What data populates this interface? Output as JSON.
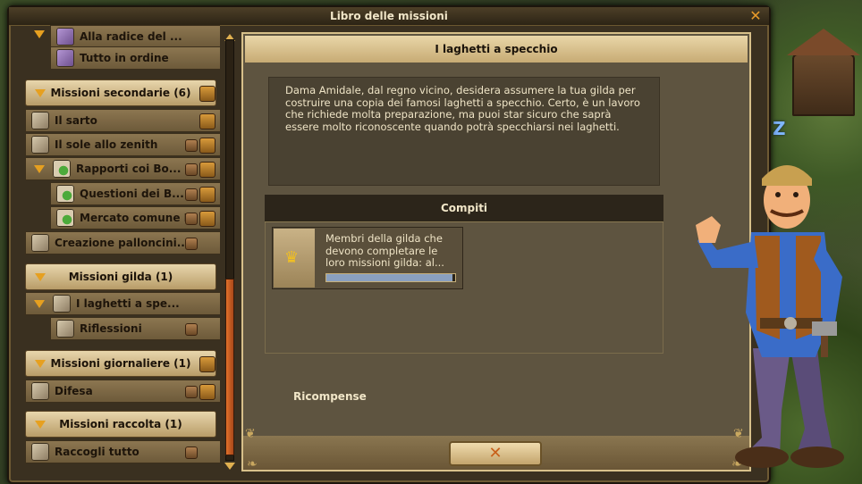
{
  "window": {
    "title": "Libro delle missioni"
  },
  "sidebar": {
    "items": [
      {
        "kind": "sub",
        "label": "Alla radice del ...",
        "icon": "purple-scroll-icon"
      },
      {
        "kind": "sub",
        "label": "Tutto in ordine",
        "icon": "purple-scroll-icon"
      },
      {
        "kind": "category",
        "label": "Missioni secondarie (6)"
      },
      {
        "kind": "quest",
        "label": "Il sarto"
      },
      {
        "kind": "quest",
        "label": "Il sole allo zenith"
      },
      {
        "kind": "quest-expand",
        "label": "Rapporti coi Bo..."
      },
      {
        "kind": "sub",
        "label": "Questioni dei B..."
      },
      {
        "kind": "sub",
        "label": "Mercato comune I"
      },
      {
        "kind": "quest",
        "label": "Creazione palloncini..."
      },
      {
        "kind": "category",
        "label": "Missioni gilda (1)"
      },
      {
        "kind": "quest-expand",
        "label": "I laghetti a spe..."
      },
      {
        "kind": "sub",
        "label": "Riflessioni"
      },
      {
        "kind": "category",
        "label": "Missioni giornaliere (1)"
      },
      {
        "kind": "quest",
        "label": "Difesa"
      },
      {
        "kind": "category",
        "label": "Missioni raccolta (1)"
      },
      {
        "kind": "quest",
        "label": "Raccogli tutto"
      }
    ]
  },
  "detail": {
    "title": "I laghetti a specchio",
    "description": "Dama Amidale, dal regno vicino, desidera assumere la tua gilda per costruire una copia dei famosi laghetti a specchio. Certo, è un lavoro che richiede molta preparazione, ma puoi star sicuro che saprà essere molto riconoscente quando potrà specchiarsi nei laghetti.",
    "tasks_header": "Compiti",
    "task": {
      "text": "Membri della gilda che devono completare le loro missioni gilda: al...",
      "icon": "crown-icon",
      "progress": 0.98
    },
    "rewards_label": "Ricompense",
    "close_label": "✕"
  },
  "colors": {
    "accent_orange": "#e0702a",
    "panel_gold": "#d7c08a"
  }
}
